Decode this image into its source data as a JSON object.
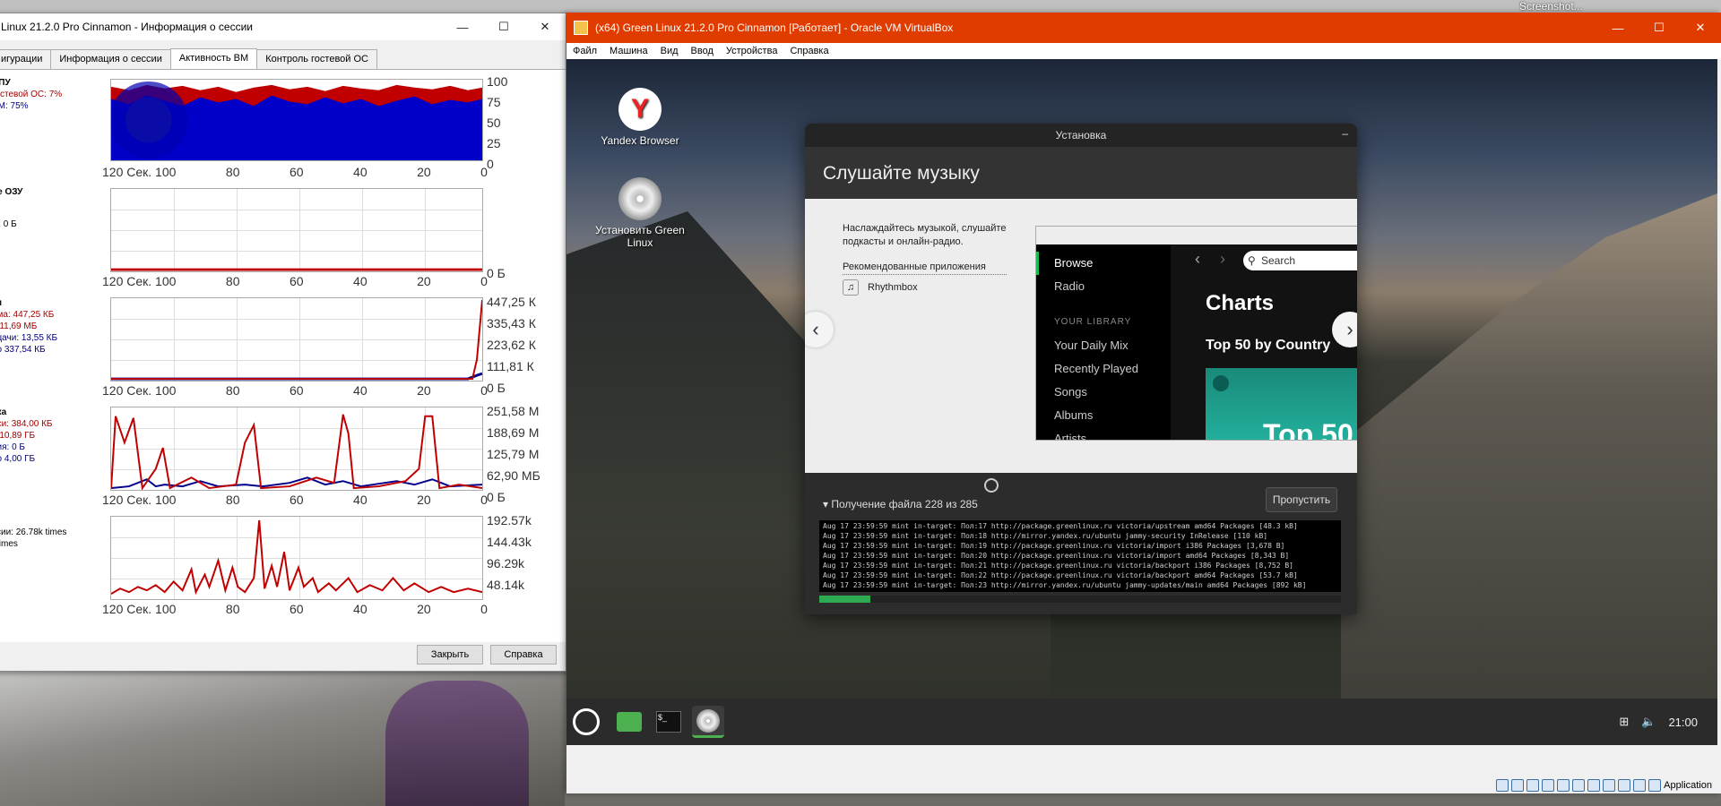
{
  "host": {
    "corner_label": "Screenshot..."
  },
  "session_window": {
    "title": "Linux 21.2.0 Pro Cinnamon - Информация о сессии",
    "tabs": [
      "игурации",
      "Информация о сессии",
      "Активность ВМ",
      "Контроль гостевой ОС"
    ],
    "active_tab": 2,
    "cpu": {
      "header": "ЦПУ",
      "line1": "гостевой ОС: 7%",
      "line2": "ВМ: 75%",
      "y_ticks": [
        "100",
        "75",
        "50",
        "25",
        "0"
      ]
    },
    "x_ticks": [
      "120 Сек. 100",
      "80",
      "60",
      "40",
      "20",
      "0"
    ],
    "ram": {
      "header": "ие ОЗУ",
      "line1": "Б",
      "line2": "ы: 0 Б",
      "y_ticks": [
        "0 Б"
      ]
    },
    "net": {
      "header": "ти",
      "line1": "ема: 447,25 КБ",
      "line2": "о 11,69 МБ",
      "line3": "едачи: 13,55 КБ",
      "line4": "но 337,54 КБ",
      "y_ticks": [
        "447,25 К",
        "335,43 К",
        "223,62 К",
        "111,81 К",
        "0 Б"
      ]
    },
    "disk": {
      "header": "ска",
      "line1": "иси: 384,00 КБ",
      "line2": "о 10,89 ГБ",
      "line3": "ния: 0 Б",
      "line4": "но 4,00 ГБ",
      "y_ticks": [
        "251,58 М",
        "188,69 М",
        "125,79 М",
        "62,90 МБ",
        "0 Б"
      ]
    },
    "exits": {
      "line1": "ссии: 26.78k times",
      "line2": "l times",
      "y_ticks": [
        "192.57k",
        "144.43k",
        "96.29k",
        "48.14k"
      ]
    },
    "close_btn": "Закрыть",
    "help_btn": "Справка"
  },
  "vbox": {
    "title": "(x64) Green Linux 21.2.0 Pro Cinnamon [Работает] - Oracle VM VirtualBox",
    "menu": [
      "Файл",
      "Машина",
      "Вид",
      "Ввод",
      "Устройства",
      "Справка"
    ],
    "status_text": "Application"
  },
  "guest": {
    "desktop_icons": [
      {
        "label": "Yandex Browser"
      },
      {
        "label": "Установить Green Linux"
      }
    ],
    "installer": {
      "title": "Установка",
      "heading": "Слушайте музыку",
      "slide_text": "Наслаждайтесь музыкой, слушайте подкасты и онлайн-радио.",
      "recommended_label": "Рекомендованные приложения",
      "recommended_app": "Rhythmbox",
      "spotify": {
        "nav": [
          "Browse",
          "Radio"
        ],
        "library_header": "YOUR LIBRARY",
        "library": [
          "Your Daily Mix",
          "Recently Played",
          "Songs",
          "Albums",
          "Artists"
        ],
        "search": "Search",
        "charts": "Charts",
        "top50_country": "Top 50 by Country",
        "card_text": "Top 50"
      },
      "progress_text": "Получение файла 228 из 285",
      "skip_btn": "Пропустить",
      "progress": 0.098,
      "log": [
        "Aug 17 23:59:59 mint in-target: Пол:17 http://package.greenlinux.ru victoria/upstream amd64 Packages [48.3 kB]",
        "Aug 17 23:59:59 mint in-target: Пол:18 http://mirror.yandex.ru/ubuntu jammy-security InRelease [110 kB]",
        "Aug 17 23:59:59 mint in-target: Пол:19 http://package.greenlinux.ru victoria/import i386 Packages [3,678 B]",
        "Aug 17 23:59:59 mint in-target: Пол:20 http://package.greenlinux.ru victoria/import amd64 Packages [8,343 B]",
        "Aug 17 23:59:59 mint in-target: Пол:21 http://package.greenlinux.ru victoria/backport i386 Packages [8,752 B]",
        "Aug 17 23:59:59 mint in-target: Пол:22 http://package.greenlinux.ru victoria/backport amd64 Packages [53.7 kB]",
        "Aug 17 23:59:59 mint in-target: Пол:23 http://mirror.yandex.ru/ubuntu jammy-updates/main amd64 Packages [892 kB]"
      ]
    },
    "panel": {
      "clock": "21:00"
    }
  }
}
